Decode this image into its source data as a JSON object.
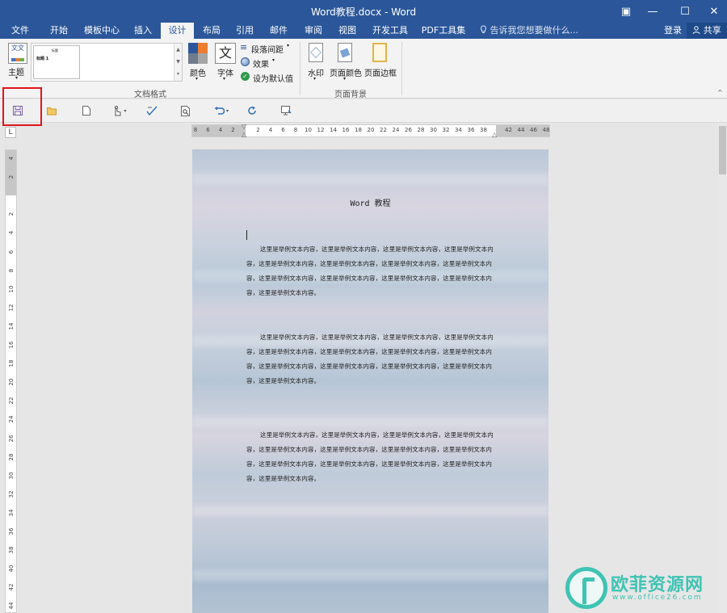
{
  "window": {
    "title": "Word教程.docx - Word",
    "controls": {
      "restore_ribbon": "▣",
      "minimize": "—",
      "maximize": "☐",
      "close": "✕"
    }
  },
  "tabs": [
    {
      "label": "文件",
      "active": false
    },
    {
      "label": "开始",
      "active": false
    },
    {
      "label": "模板中心",
      "active": false
    },
    {
      "label": "插入",
      "active": false
    },
    {
      "label": "设计",
      "active": true
    },
    {
      "label": "布局",
      "active": false
    },
    {
      "label": "引用",
      "active": false
    },
    {
      "label": "邮件",
      "active": false
    },
    {
      "label": "审阅",
      "active": false
    },
    {
      "label": "视图",
      "active": false
    },
    {
      "label": "开发工具",
      "active": false
    },
    {
      "label": "PDF工具集",
      "active": false
    }
  ],
  "tell_me": {
    "icon": "lightbulb-icon",
    "placeholder": "告诉我您想要做什么..."
  },
  "account": {
    "login": "登录",
    "share": "共享"
  },
  "ribbon": {
    "theme": {
      "label": "主题",
      "icon_text": "文文"
    },
    "style_gallery": {
      "thumb_title": "标题",
      "thumb_heading": "标题 1"
    },
    "colors": {
      "label": "颜色"
    },
    "fonts": {
      "label": "字体",
      "icon_text": "文"
    },
    "paragraph_spacing": {
      "label": "段落间距"
    },
    "effects": {
      "label": "效果"
    },
    "set_default": {
      "label": "设为默认值"
    },
    "group_document_format": "文档格式",
    "watermark": {
      "label": "水印"
    },
    "page_color": {
      "label": "页面颜色"
    },
    "page_borders": {
      "label": "页面边框"
    },
    "group_page_background": "页面背景"
  },
  "quick_access": [
    {
      "name": "save-button",
      "icon": "save-icon",
      "highlighted": true
    },
    {
      "name": "open-button",
      "icon": "folder-open-icon"
    },
    {
      "name": "new-button",
      "icon": "new-document-icon"
    },
    {
      "name": "touch-mode-button",
      "icon": "touch-hand-icon"
    },
    {
      "name": "spelling-button",
      "icon": "spelling-check-icon"
    },
    {
      "name": "print-preview-button",
      "icon": "print-preview-icon"
    },
    {
      "name": "undo-button",
      "icon": "undo-icon"
    },
    {
      "name": "redo-button",
      "icon": "redo-icon"
    },
    {
      "name": "screen-button",
      "icon": "screen-icon"
    }
  ],
  "rulers": {
    "horizontal_ticks": [
      "8",
      "6",
      "4",
      "2",
      "",
      "2",
      "4",
      "6",
      "8",
      "10",
      "12",
      "14",
      "16",
      "18",
      "20",
      "22",
      "24",
      "26",
      "28",
      "30",
      "32",
      "34",
      "36",
      "38",
      "",
      "42",
      "44",
      "46",
      "48"
    ],
    "vertical_ticks": [
      "4",
      "2",
      "",
      "2",
      "4",
      "6",
      "8",
      "10",
      "12",
      "14",
      "16",
      "18",
      "20",
      "22",
      "24",
      "26",
      "28",
      "30",
      "32",
      "34",
      "36",
      "38",
      "40",
      "42",
      "44"
    ],
    "corner_symbol": "L"
  },
  "document": {
    "title": "Word 教程",
    "paragraphs": [
      "这里是举例文本内容，这里是举例文本内容，这里是举例文本内容，这里是举例文本内容，这里是举例文本内容，这里是举例文本内容，这里是举例文本内容，这里是举例文本内容，这里是举例文本内容，这里是举例文本内容，这里是举例文本内容，这里是举例文本内容，这里是举例文本内容。",
      "这里是举例文本内容，这里是举例文本内容，这里是举例文本内容，这里是举例文本内容，这里是举例文本内容，这里是举例文本内容，这里是举例文本内容，这里是举例文本内容，这里是举例文本内容，这里是举例文本内容，这里是举例文本内容，这里是举例文本内容，这里是举例文本内容。",
      "这里是举例文本内容，这里是举例文本内容，这里是举例文本内容，这里是举例文本内容，这里是举例文本内容，这里是举例文本内容，这里是举例文本内容，这里是举例文本内容，这里是举例文本内容，这里是举例文本内容，这里是举例文本内容，这里是举例文本内容，这里是举例文本内容。"
    ]
  },
  "watermark": {
    "brand": "欧菲资源网",
    "url": "www.office26.com"
  },
  "colors": {
    "titlebar": "#2b579a",
    "highlight_box": "#e0141b",
    "watermark": "#3fc3b4"
  }
}
